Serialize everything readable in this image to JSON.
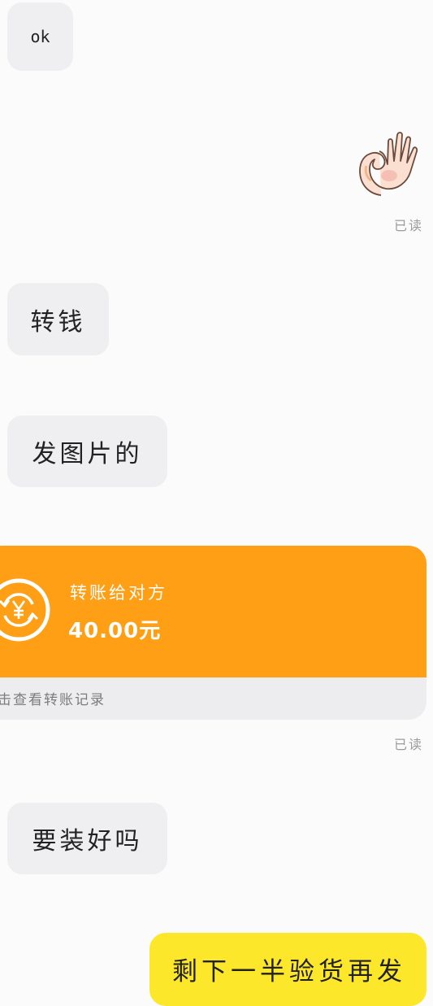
{
  "messages": [
    {
      "id": "m1",
      "side": "received",
      "text": "ok"
    },
    {
      "id": "m2",
      "side": "sent",
      "type": "sticker",
      "sticker": "ok-hand"
    },
    {
      "id": "m3",
      "side": "received",
      "text": "转钱"
    },
    {
      "id": "m4",
      "side": "received",
      "text": "发图片的"
    },
    {
      "id": "m5",
      "side": "received",
      "text": "要装好吗"
    },
    {
      "id": "m6",
      "side": "sent",
      "text": "剩下一半验货再发"
    }
  ],
  "read_receipts": [
    "已读",
    "已读"
  ],
  "transfer": {
    "title": "转账给对方",
    "amount": "40.00元",
    "footer": "点击查看转账记录",
    "icon": "yuan-exchange-icon",
    "color": "#ff9f16"
  },
  "colors": {
    "received_bubble": "#efeff2",
    "sent_bubble": "#fde72b",
    "background": "#fbfbfb"
  }
}
